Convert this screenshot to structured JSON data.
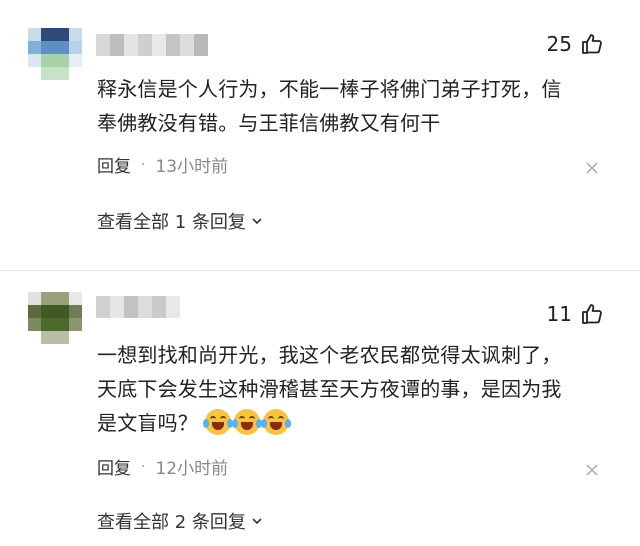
{
  "comments": [
    {
      "likes": "25",
      "text_lines": [
        "释永信是个人行为，不能一棒子将佛门弟子打死，信",
        "奉佛教没有错。与王菲信佛教又有何干"
      ],
      "reply_label": "回复",
      "separator": "·",
      "time": "13小时前",
      "view_replies": "查看全部 1 条回复"
    },
    {
      "likes": "11",
      "text_lines": [
        "一想到找和尚开光，我这个老农民都觉得太讽刺了，",
        "天底下会发生这种滑稽甚至天方夜谭的事，是因为我",
        "是文盲吗？"
      ],
      "reply_label": "回复",
      "separator": "·",
      "time": "12小时前",
      "view_replies": "查看全部 2 条回复"
    }
  ],
  "icons": {
    "like": "thumbs-up-icon",
    "close": "close-icon",
    "chevron": "chevron-down-icon",
    "emoji": "laugh-cry-emoji-icon"
  },
  "colors": {
    "text": "#222222",
    "meta": "#888888",
    "divider": "#e6e6e6"
  }
}
